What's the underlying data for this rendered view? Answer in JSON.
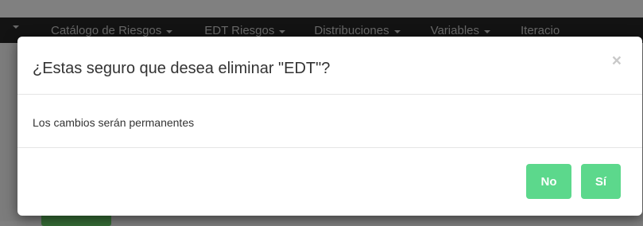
{
  "navbar": {
    "items": [
      {
        "label": "Catálogo de Riesgos"
      },
      {
        "label": "EDT Riesgos"
      },
      {
        "label": "Distribuciones"
      },
      {
        "label": "Variables"
      },
      {
        "label": "Iteracio"
      }
    ]
  },
  "modal": {
    "title": "¿Estas seguro que desea eliminar \"EDT\"?",
    "close_label": "×",
    "body_text": "Los cambios serán permanentes",
    "buttons": {
      "no_label": "No",
      "si_label": "Sí"
    },
    "button_color": "#5cd88c"
  }
}
